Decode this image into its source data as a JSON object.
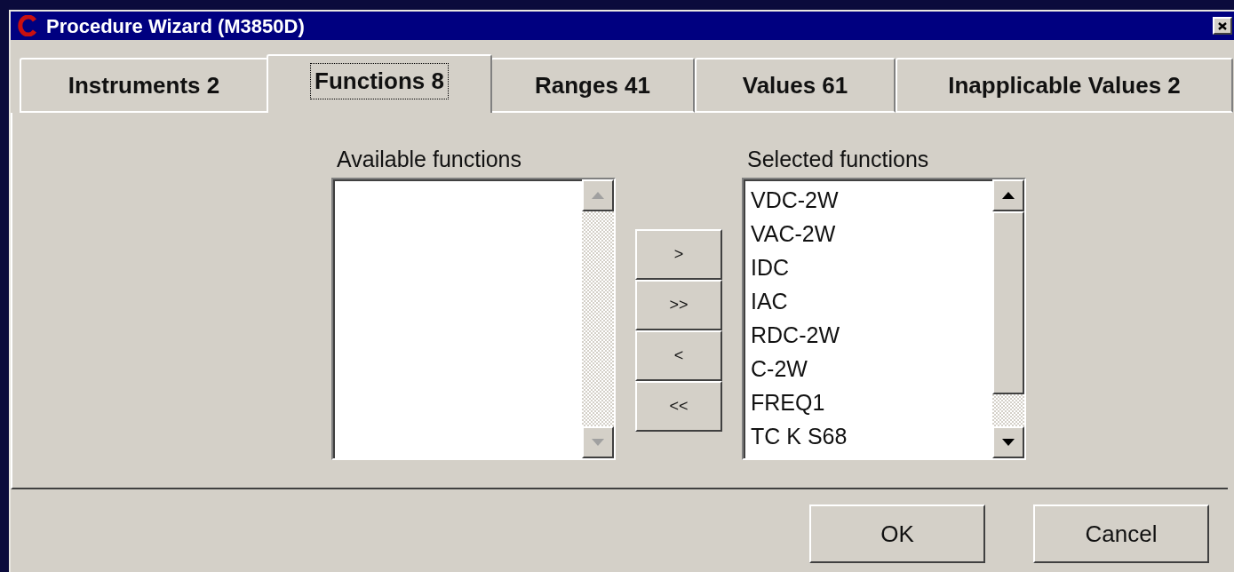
{
  "window": {
    "title": "Procedure Wizard (M3850D)"
  },
  "tabs": [
    {
      "label": "Instruments 2",
      "selected": false
    },
    {
      "label": "Functions 8",
      "selected": true
    },
    {
      "label": "Ranges 41",
      "selected": false
    },
    {
      "label": "Values 61",
      "selected": false
    },
    {
      "label": "Inapplicable Values 2",
      "selected": false
    }
  ],
  "available_list": {
    "label": "Available functions",
    "disabled": true
  },
  "move_buttons": [
    ">",
    ">>",
    "<",
    "<<"
  ],
  "selected_list": {
    "label": "Selected functions",
    "disabled": false,
    "items": [
      "VDC-2W",
      "VAC-2W",
      "IDC",
      "IAC",
      "RDC-2W",
      "C-2W",
      "FREQ1",
      "TC K S68"
    ]
  },
  "buttons": [
    "OK",
    "Cancel"
  ]
}
